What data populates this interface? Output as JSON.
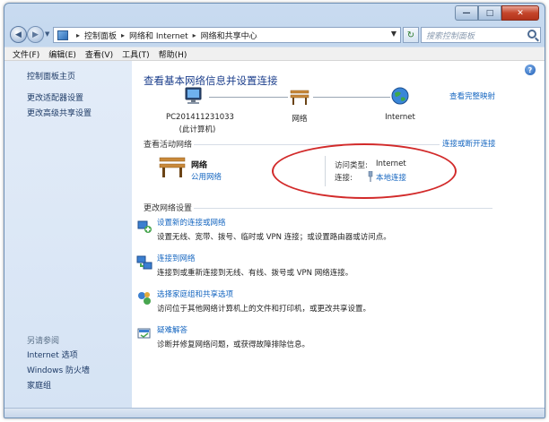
{
  "window": {
    "caption_buttons": {
      "minimize": "—",
      "maximize": "□",
      "close": "✕"
    }
  },
  "address_bar": {
    "back": "◀",
    "forward": "▶",
    "crumbs": [
      "控制面板",
      "网络和 Internet",
      "网络和共享中心"
    ],
    "search_placeholder": "搜索控制面板"
  },
  "menu": {
    "items": [
      "文件(F)",
      "编辑(E)",
      "查看(V)",
      "工具(T)",
      "帮助(H)"
    ]
  },
  "sidebar": {
    "items": [
      "控制面板主页",
      "更改适配器设置",
      "更改高级共享设置"
    ],
    "see_also_title": "另请参阅",
    "see_also": [
      "Internet 选项",
      "Windows 防火墙",
      "家庭组"
    ]
  },
  "main": {
    "title": "查看基本网络信息并设置连接",
    "view_full_map": "查看完整映射",
    "nodes": [
      {
        "label": "PC201411231033",
        "sublabel": "(此计算机)",
        "icon": "computer-icon"
      },
      {
        "label": "网络",
        "icon": "bench-network-icon"
      },
      {
        "label": "Internet",
        "icon": "globe-icon"
      }
    ],
    "active_networks_head": "查看活动网络",
    "connect_disconnect": "连接或断开连接",
    "active_network": {
      "name": "网络",
      "type": "公用网络",
      "access_type_label": "访问类型:",
      "access_type_value": "Internet",
      "connection_label": "连接:",
      "connection_value": "本地连接"
    },
    "change_settings_head": "更改网络设置",
    "tasks": [
      {
        "title": "设置新的连接或网络",
        "desc": "设置无线、宽带、拨号、临时或 VPN 连接；或设置路由器或访问点。",
        "icon": "new-connection-icon"
      },
      {
        "title": "连接到网络",
        "desc": "连接到或重新连接到无线、有线、拨号或 VPN 网络连接。",
        "icon": "connect-network-icon"
      },
      {
        "title": "选择家庭组和共享选项",
        "desc": "访问位于其他网络计算机上的文件和打印机，或更改共享设置。",
        "icon": "homegroup-icon"
      },
      {
        "title": "疑难解答",
        "desc": "诊断并修复网络问题，或获得故障排除信息。",
        "icon": "troubleshoot-icon"
      }
    ]
  },
  "colors": {
    "link": "#1566c0",
    "title": "#1c3f8c",
    "sidebar_bg": "#dbe7f6",
    "annotation": "#d22a2a"
  }
}
